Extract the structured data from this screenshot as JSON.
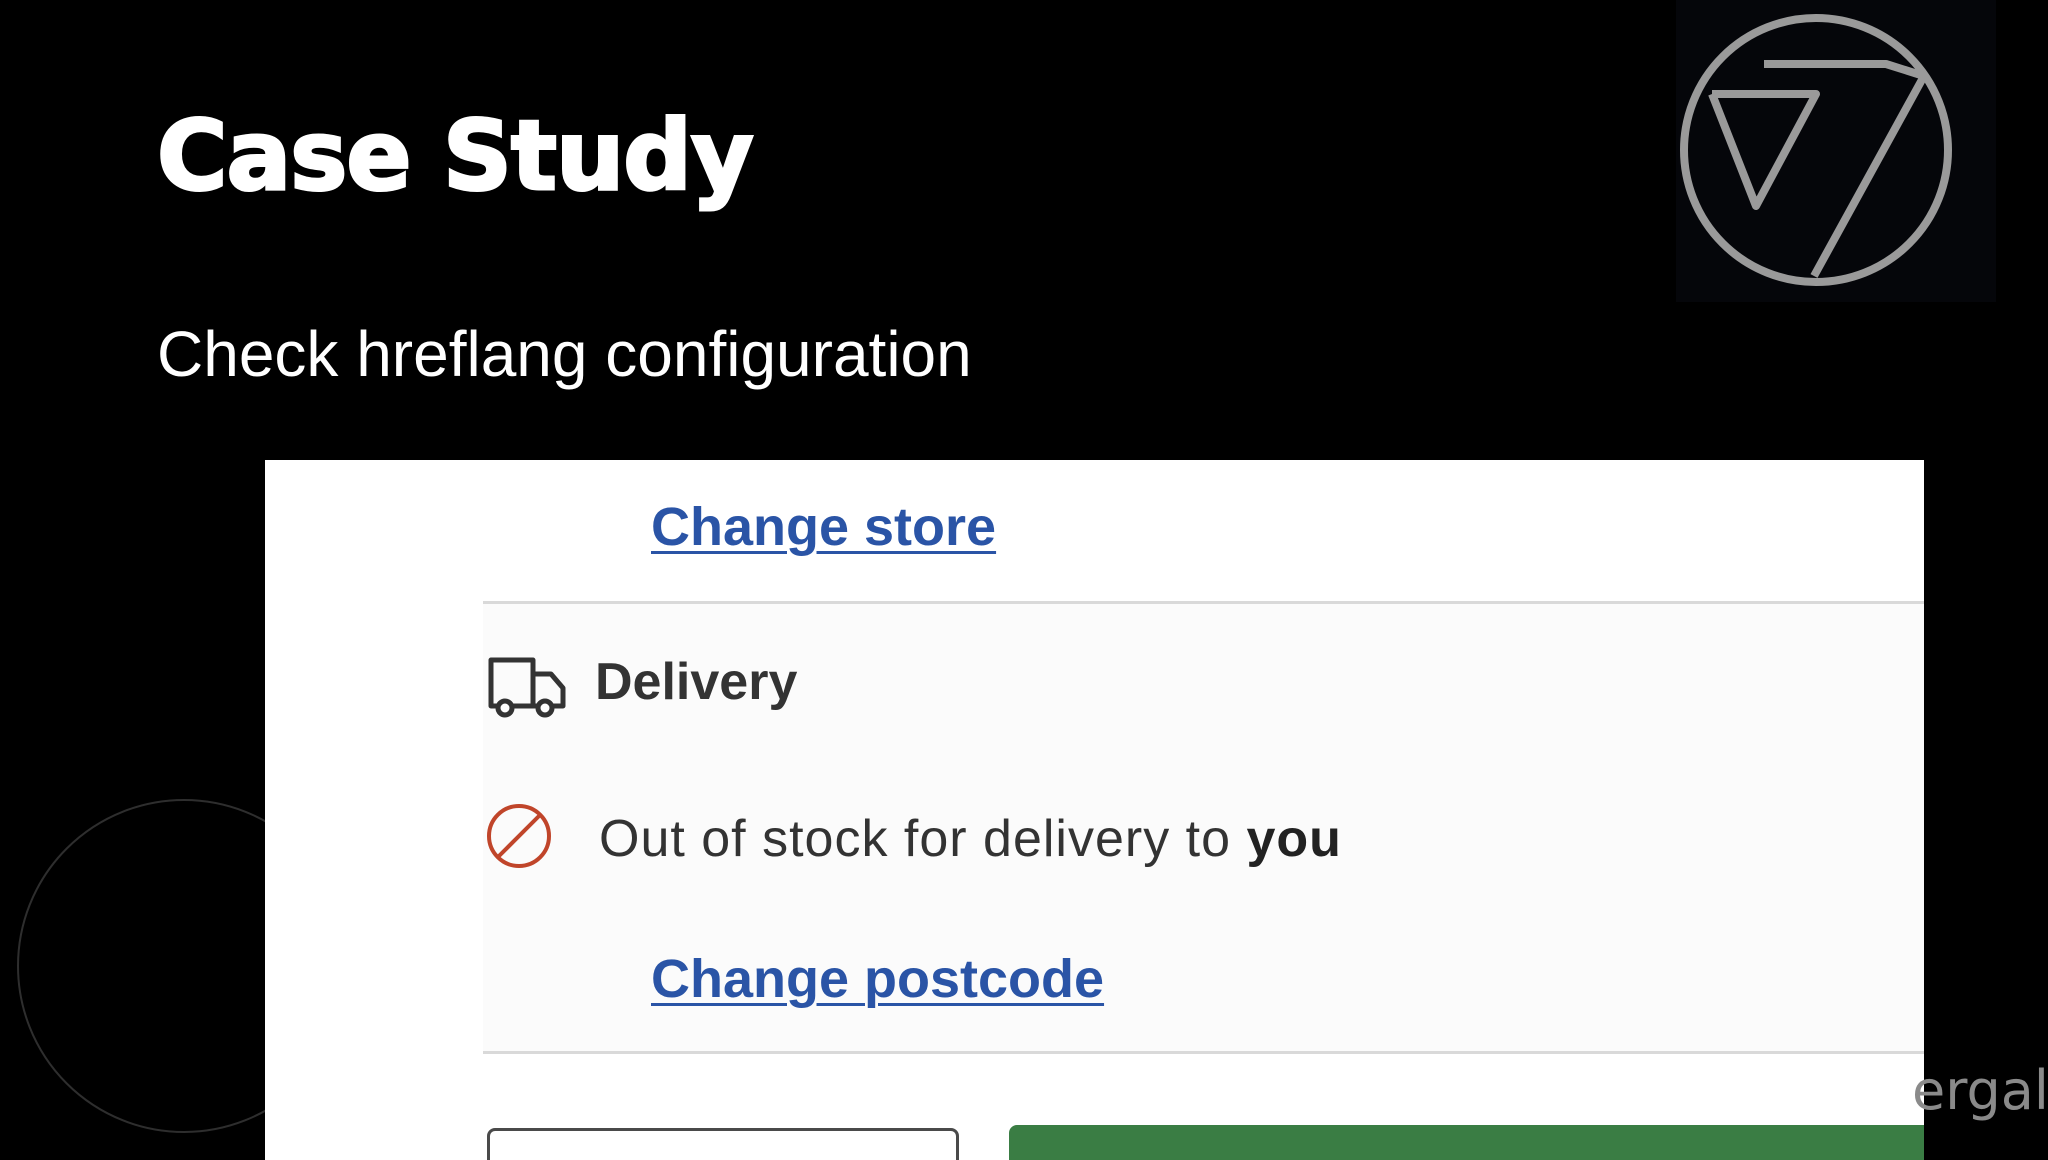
{
  "slide": {
    "title": "Case Study",
    "subtitle": "Check hreflang configuration",
    "watermark": "ergal"
  },
  "logo": {
    "icon": "seven-circle-logo-icon"
  },
  "screenshot": {
    "change_store_link": "Change store",
    "delivery": {
      "icon": "truck-icon",
      "heading": "Delivery"
    },
    "stock": {
      "icon": "prohibited-icon",
      "message": "Out of stock for delivery to",
      "emphasis": "you"
    },
    "change_postcode_link": "Change postcode",
    "colors": {
      "link": "#2a54a6",
      "prohibited": "#c0452a",
      "primary_button": "#3a7d44"
    }
  }
}
